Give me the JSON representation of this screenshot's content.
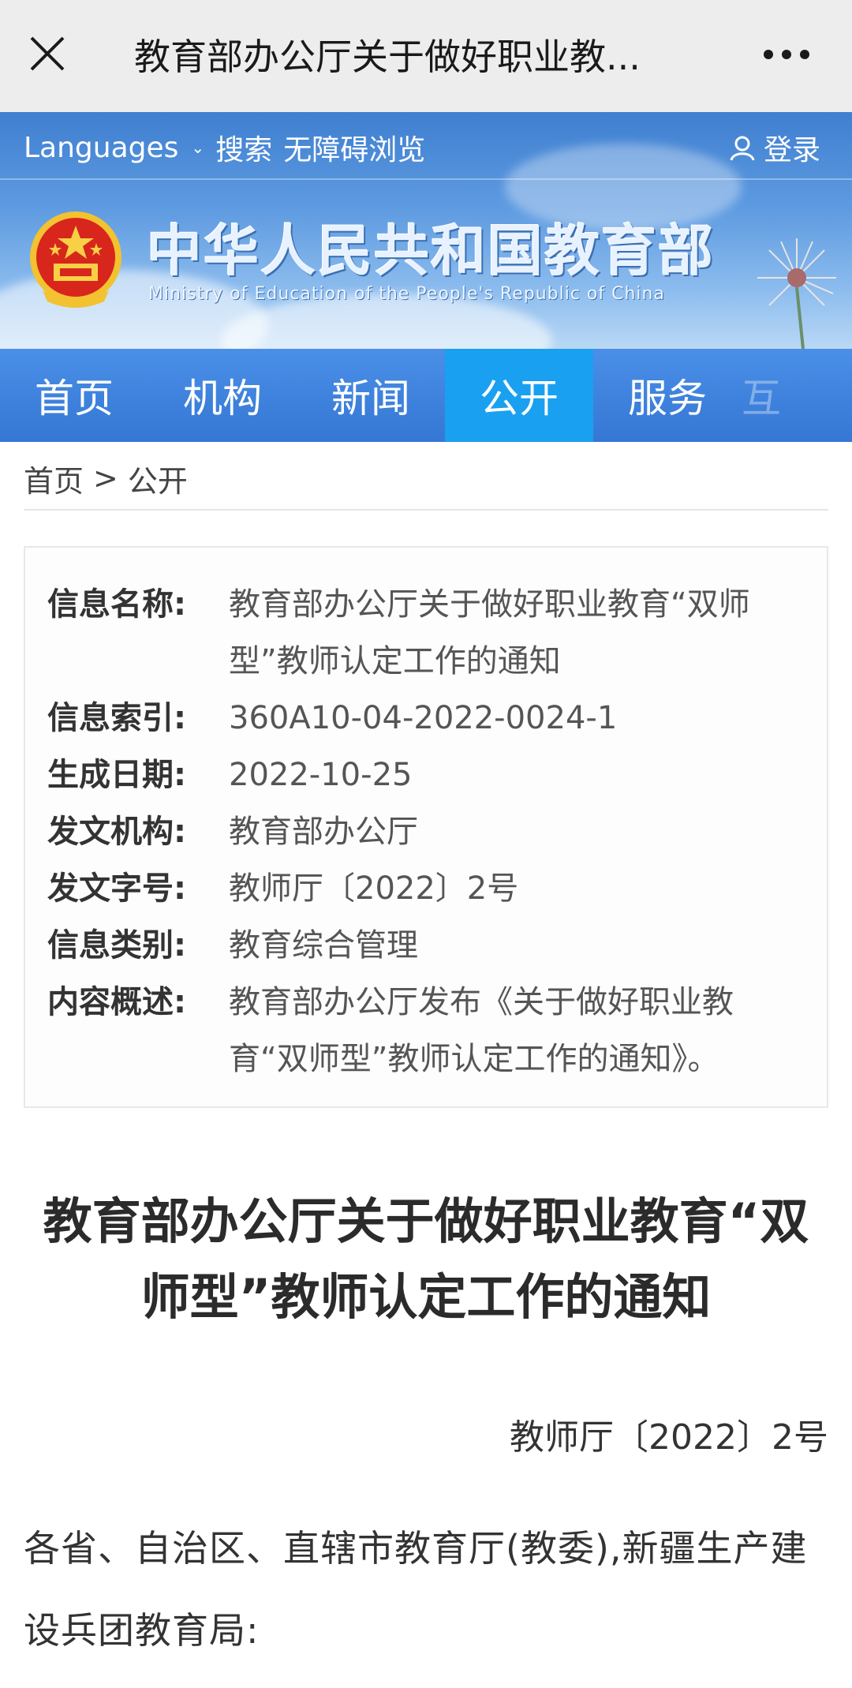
{
  "topbar": {
    "title": "教育部办公厅关于做好职业教..."
  },
  "banner": {
    "languages": "Languages",
    "search": "搜索",
    "accessibility": "无障碍浏览",
    "login": "登录",
    "site_title": "中华人民共和国教育部",
    "site_subtitle": "Ministry of Education of the People's Republic of China"
  },
  "nav": {
    "items": [
      {
        "label": "首页"
      },
      {
        "label": "机构"
      },
      {
        "label": "新闻"
      },
      {
        "label": "公开"
      },
      {
        "label": "服务"
      },
      {
        "label": "互"
      }
    ],
    "active": "公开"
  },
  "breadcrumb": {
    "home": "首页",
    "separator": ">",
    "current": "公开"
  },
  "info": {
    "rows": [
      {
        "label": "信息名称:",
        "value": "教育部办公厅关于做好职业教育“双师型”教师认定工作的通知"
      },
      {
        "label": "信息索引:",
        "value": "360A10-04-2022-0024-1"
      },
      {
        "label": "生成日期:",
        "value": "2022-10-25"
      },
      {
        "label": "发文机构:",
        "value": "教育部办公厅"
      },
      {
        "label": "发文字号:",
        "value": "教师厅〔2022〕2号"
      },
      {
        "label": "信息类别:",
        "value": "教育综合管理"
      },
      {
        "label": "内容概述:",
        "value": "教育部办公厅发布《关于做好职业教育“双师型”教师认定工作的通知》。"
      }
    ]
  },
  "article": {
    "title": "教育部办公厅关于做好职业教育“双师型”教师认定工作的通知",
    "doc_number": "教师厅〔2022〕2号",
    "salutation": "各省、自治区、直辖市教育厅(教委),新疆生产建设兵团教育局:"
  }
}
